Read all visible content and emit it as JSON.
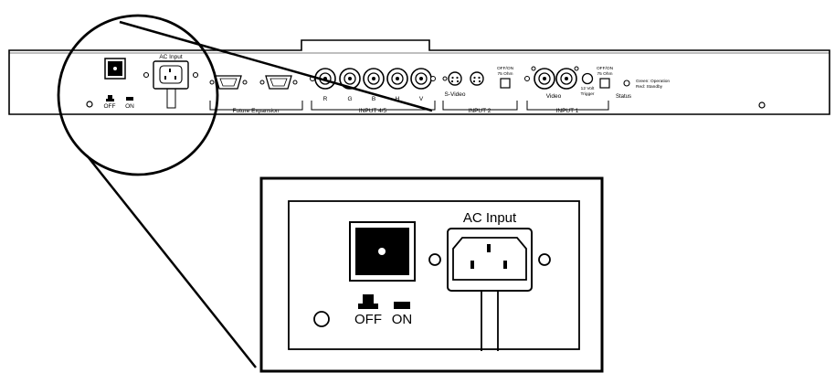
{
  "panel": {
    "ac_input": "AC Input",
    "off": "OFF",
    "on": "ON",
    "future_expansion": "Future Expansion",
    "input45": "INPUT 4/5",
    "rgbhv": [
      "R",
      "G",
      "B",
      "H",
      "V"
    ],
    "svideo": "S-Video",
    "input2": "INPUT 2",
    "offon": "OFF/ON",
    "ohm": "75 Ohm",
    "video": "Video",
    "trigger_line1": "12 Volt",
    "trigger_line2": "Trigger",
    "input1": "INPUT 1",
    "status": "Status",
    "green": "Green: Operation",
    "red": "Red: Standby"
  },
  "detail": {
    "ac_input": "AC Input",
    "off": "OFF",
    "on": "ON"
  }
}
